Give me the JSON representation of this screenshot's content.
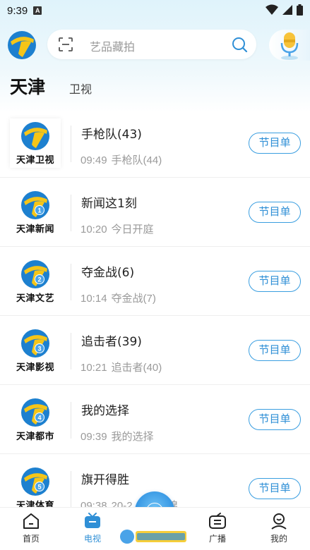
{
  "status_bar": {
    "time": "9:39",
    "badge": "A"
  },
  "header": {
    "search_placeholder": "艺品藏拍"
  },
  "categories": {
    "active": "天津",
    "inactive": "卫视"
  },
  "channels": [
    {
      "name": "天津卫视",
      "badge": "",
      "current": "手枪队(43)",
      "next_time": "09:49",
      "next_title": "手枪队(44)",
      "button": "节目单"
    },
    {
      "name": "天津新闻",
      "badge": "1",
      "current": "新闻这1刻",
      "next_time": "10:20",
      "next_title": "今日开庭",
      "button": "节目单"
    },
    {
      "name": "天津文艺",
      "badge": "2",
      "current": "夺金战(6)",
      "next_time": "10:14",
      "next_title": "夺金战(7)",
      "button": "节目单"
    },
    {
      "name": "天津影视",
      "badge": "3",
      "current": "追击者(39)",
      "next_time": "10:21",
      "next_title": "追击者(40)",
      "button": "节目单"
    },
    {
      "name": "天津都市",
      "badge": "4",
      "current": "我的选择",
      "next_time": "09:39",
      "next_title": "我的选择",
      "button": "节目单"
    },
    {
      "name": "天津体育",
      "badge": "5",
      "current": "旗开得胜",
      "next_time": "09:38",
      "next_title": "20-2… 排集锦",
      "button": "节目单"
    }
  ],
  "bottom_nav": {
    "home": "首页",
    "tv": "电视",
    "broadcast": "广播",
    "mine": "我的"
  },
  "remote": {
    "ok_label": "OK"
  },
  "colors": {
    "accent": "#2f8fd6",
    "logo_blue": "#1d80cf",
    "logo_yellow": "#f5c518"
  }
}
